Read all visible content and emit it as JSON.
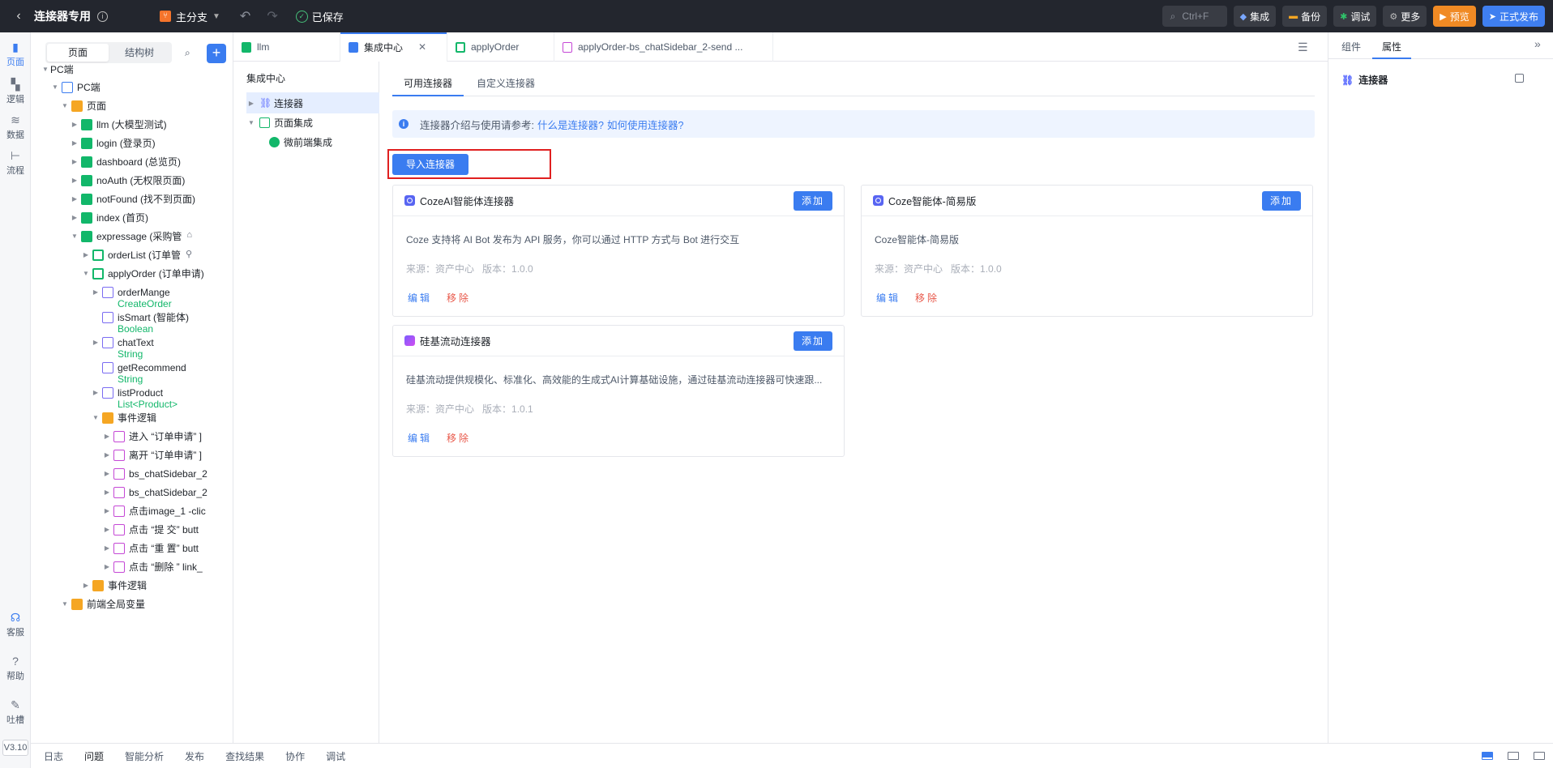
{
  "topbar": {
    "back": "‹",
    "title": "连接器专用",
    "branch": "主分支",
    "saved": "已保存",
    "search_shortcut": "Ctrl+F",
    "buttons": [
      "集成",
      "备份",
      "调试",
      "更多",
      "预览",
      "正式发布"
    ]
  },
  "rail": {
    "items": [
      {
        "label": "页面",
        "icon": "page-icon"
      },
      {
        "label": "逻辑",
        "icon": "logic-icon"
      },
      {
        "label": "数据",
        "icon": "database-icon"
      },
      {
        "label": "流程",
        "icon": "flow-icon"
      },
      {
        "label": "客服",
        "icon": "headset-icon"
      },
      {
        "label": "帮助",
        "icon": "help-icon"
      },
      {
        "label": "吐槽",
        "icon": "feedback-icon"
      }
    ],
    "version": "V3.10"
  },
  "treepanel": {
    "segments": [
      "页面",
      "结构树"
    ],
    "add": "+",
    "nodes": [
      {
        "label": "PC端"
      },
      {
        "label": "PC端"
      },
      {
        "label": "页面"
      },
      {
        "label": "llm (大模型测试)"
      },
      {
        "label": "login (登录页)"
      },
      {
        "label": "dashboard (总览页)"
      },
      {
        "label": "noAuth (无权限页面)"
      },
      {
        "label": "notFound (找不到页面)"
      },
      {
        "label": "index (首页)"
      },
      {
        "label": "expressage (采购管"
      },
      {
        "label": "orderList (订单管"
      },
      {
        "label": "applyOrder (订单申请)"
      },
      {
        "label": "orderMange",
        "sub": "CreateOrder"
      },
      {
        "label": "isSmart (智能体)",
        "sub": "Boolean"
      },
      {
        "label": "chatText",
        "sub": "String"
      },
      {
        "label": "getRecommend",
        "sub": "String"
      },
      {
        "label": "listProduct",
        "sub": "List<Product>"
      },
      {
        "label": "事件逻辑"
      },
      {
        "label": "进入 “订单申请” ]"
      },
      {
        "label": "离开 “订单申请” ]"
      },
      {
        "label": "bs_chatSidebar_2"
      },
      {
        "label": "bs_chatSidebar_2"
      },
      {
        "label": "点击image_1 -clic"
      },
      {
        "label": "点击 “提 交” butt"
      },
      {
        "label": "点击 “重 置” butt"
      },
      {
        "label": "点击 “删除 ” link_"
      },
      {
        "label": "事件逻辑"
      },
      {
        "label": "前端全局变量"
      }
    ]
  },
  "tabs": [
    {
      "label": "llm"
    },
    {
      "label": "集成中心"
    },
    {
      "label": "applyOrder"
    },
    {
      "label": "applyOrder-bs_chatSidebar_2-send ..."
    }
  ],
  "intnav": {
    "title": "集成中心",
    "items": [
      "连接器",
      "页面集成",
      "微前端集成"
    ]
  },
  "main": {
    "tabs": [
      "可用连接器",
      "自定义连接器"
    ],
    "notice_prefix": "连接器介绍与使用请参考:",
    "notice_link1": "什么是连接器?",
    "notice_link2": "如何使用连接器?",
    "import_button": "导入连接器",
    "cards": [
      {
        "title": "CozeAI智能体连接器",
        "desc": "Coze 支持将 AI Bot 发布为 API 服务，你可以通过 HTTP 方式与 Bot 进行交互",
        "source": "来源：资产中心",
        "version": "版本：1.0.0",
        "add": "添加",
        "edit": "编辑",
        "del": "移除"
      },
      {
        "title": "Coze智能体-简易版",
        "desc": "Coze智能体-简易版",
        "source": "来源：资产中心",
        "version": "版本：1.0.0",
        "add": "添加",
        "edit": "编辑",
        "del": "移除"
      },
      {
        "title": "硅基流动连接器",
        "desc": "硅基流动提供规模化、标准化、高效能的生成式AI计算基础设施，通过硅基流动连接器可快速跟...",
        "source": "来源：资产中心",
        "version": "版本：1.0.1",
        "add": "添加",
        "edit": "编辑",
        "del": "移除"
      }
    ]
  },
  "rightpanel": {
    "tabs": [
      "组件",
      "属性"
    ],
    "selected": "连接器"
  },
  "bottombar": {
    "items": [
      "日志",
      "问题",
      "智能分析",
      "发布",
      "查找结果",
      "协作",
      "调试"
    ]
  }
}
